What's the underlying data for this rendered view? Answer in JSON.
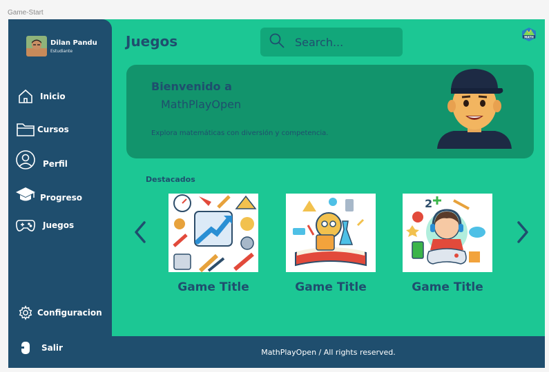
{
  "frame_label": "Game-Start",
  "user": {
    "name": "Dilan Pandu",
    "role": "Estudiante"
  },
  "sidebar": {
    "items": [
      {
        "label": "Inicio",
        "icon": "home-icon"
      },
      {
        "label": "Cursos",
        "icon": "folder-icon"
      },
      {
        "label": "Perfil",
        "icon": "user-icon"
      },
      {
        "label": "Progreso",
        "icon": "graduation-cap-icon"
      },
      {
        "label": "Juegos",
        "icon": "gamepad-icon"
      }
    ],
    "settings_label": "Configuracion",
    "logout_label": "Salir"
  },
  "header": {
    "title": "Juegos",
    "search_placeholder": "Search...",
    "logo_text": "MATH"
  },
  "hero": {
    "title": "Bienvenido a",
    "subtitle": "MathPlayOpen",
    "description": "Explora matemáticas con diversión y competencia."
  },
  "featured": {
    "label": "Destacados",
    "cards": [
      {
        "title": "Game Title"
      },
      {
        "title": "Game Title"
      },
      {
        "title": "Game Title"
      }
    ]
  },
  "footer": {
    "text": "MathPlayOpen / All rights reserved."
  },
  "colors": {
    "background": "#1cc794",
    "sidebar": "#1f4e6e",
    "hero": "#12946c",
    "search": "#12a77a"
  }
}
